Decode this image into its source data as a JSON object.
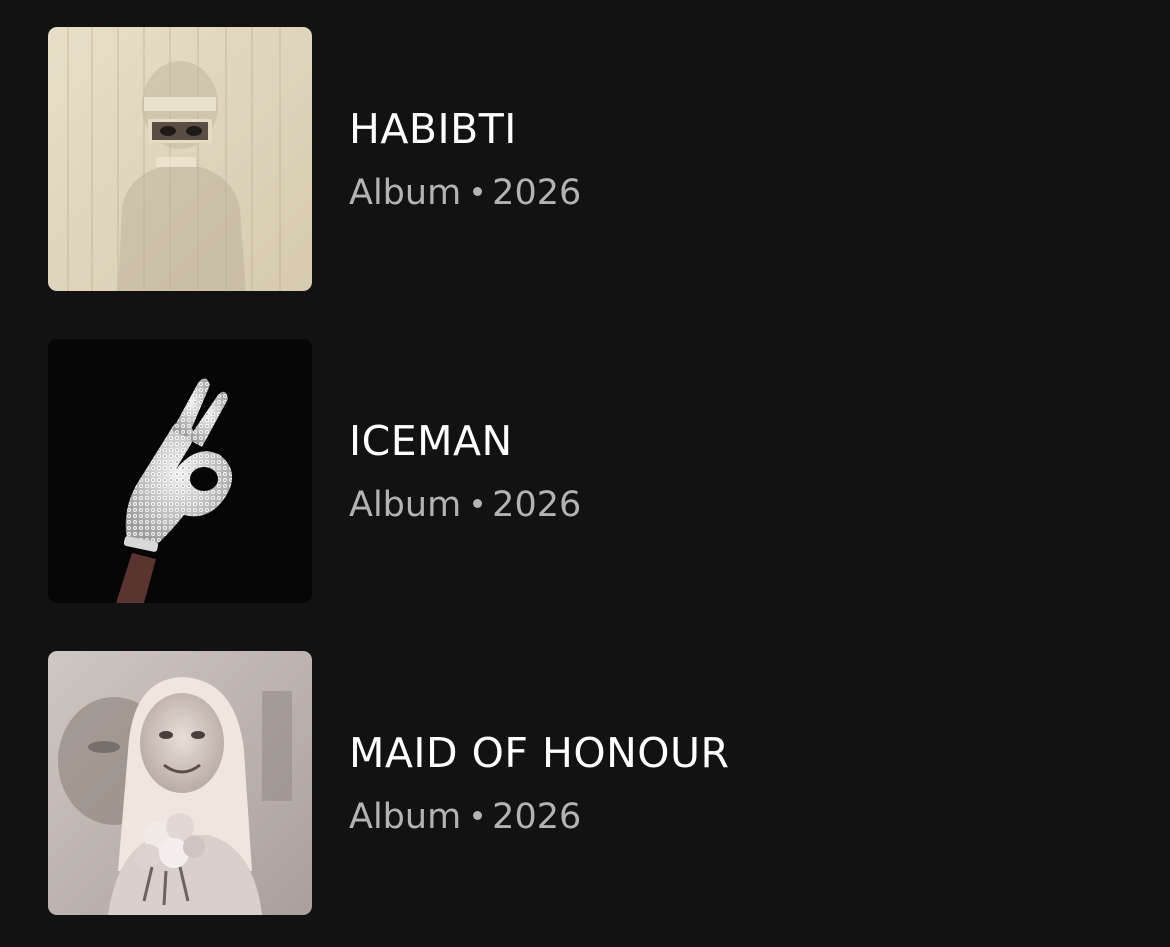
{
  "albums": [
    {
      "title": "HABIBTI",
      "type": "Album",
      "year": "2026",
      "cover_icon": "album-cover-veiled-figure"
    },
    {
      "title": "ICEMAN",
      "type": "Album",
      "year": "2026",
      "cover_icon": "album-cover-jeweled-glove-ok-hand"
    },
    {
      "title": "MAID OF HONOUR",
      "type": "Album",
      "year": "2026",
      "cover_icon": "album-cover-bride-portrait"
    }
  ],
  "colors": {
    "background": "#121212",
    "title": "#ffffff",
    "subtitle": "#b3b3b3"
  }
}
